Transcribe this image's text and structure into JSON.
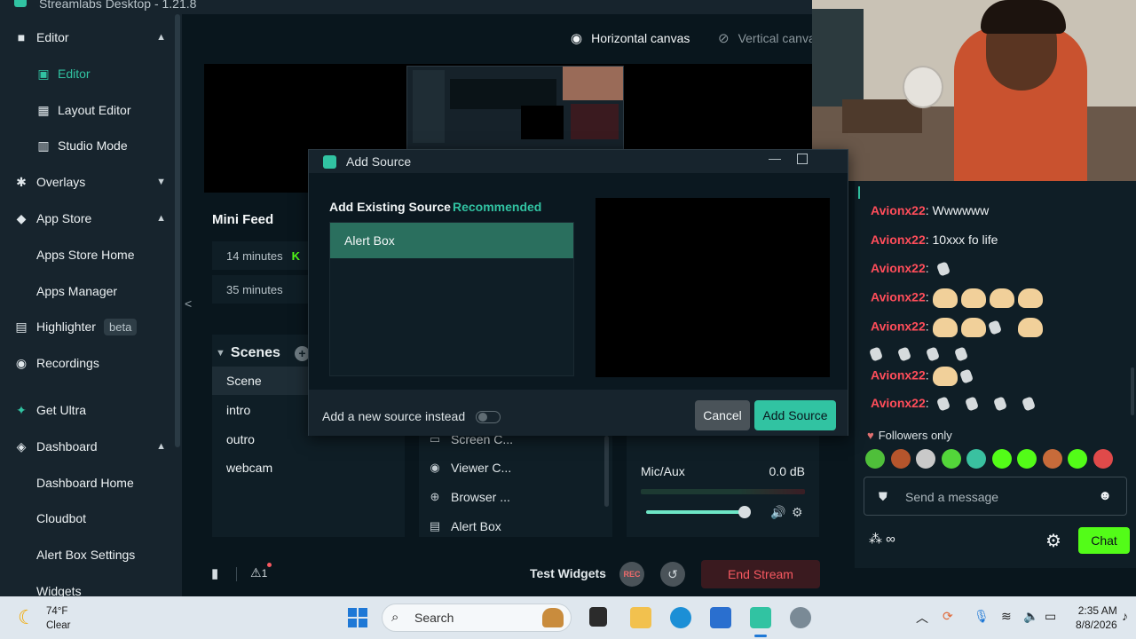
{
  "titlebar": {
    "title": "Streamlabs Desktop - 1.21.8"
  },
  "sidebar": {
    "items": [
      {
        "label": "Editor",
        "icon": "camera-icon",
        "chevron": "▲"
      },
      {
        "label": "Editor",
        "icon": "editor-icon"
      },
      {
        "label": "Layout Editor",
        "icon": "layout-icon"
      },
      {
        "label": "Studio Mode",
        "icon": "studio-icon"
      },
      {
        "label": "Overlays",
        "icon": "overlays-icon",
        "chevron": "▼"
      },
      {
        "label": "App Store",
        "icon": "store-icon",
        "chevron": "▲"
      },
      {
        "label": "Apps Store Home"
      },
      {
        "label": "Apps Manager"
      },
      {
        "label": "Highlighter",
        "icon": "highlighter-icon",
        "badge": "beta"
      },
      {
        "label": "Recordings",
        "icon": "recordings-icon"
      },
      {
        "label": "Get Ultra",
        "icon": "ultra-icon"
      },
      {
        "label": "Dashboard",
        "icon": "dashboard-icon",
        "chevron": "▲"
      },
      {
        "label": "Dashboard Home"
      },
      {
        "label": "Cloudbot"
      },
      {
        "label": "Alert Box Settings"
      },
      {
        "label": "Widgets"
      }
    ]
  },
  "editor": {
    "canvas_horizontal": "Horizontal canvas",
    "canvas_vertical": "Vertical canvas",
    "mini_feed": {
      "title": "Mini Feed",
      "rows": [
        {
          "time": "14 minutes"
        },
        {
          "time": "35 minutes"
        }
      ]
    },
    "scenes": {
      "title": "Scenes",
      "items": [
        "Scene",
        "intro",
        "outro",
        "webcam"
      ]
    },
    "sources": {
      "items": [
        {
          "label": "Screen C...",
          "icon": "monitor-icon"
        },
        {
          "label": "Viewer C...",
          "icon": "eye-icon"
        },
        {
          "label": "Browser ...",
          "icon": "globe-icon"
        },
        {
          "label": "Alert Box",
          "icon": "alert-icon"
        }
      ]
    },
    "mixer": {
      "label": "Mic/Aux",
      "db": "0.0 dB",
      "volume": 0.85
    }
  },
  "footer": {
    "alerts_count": "1",
    "test_widgets": "Test Widgets",
    "rec": "REC",
    "end_stream": "End Stream"
  },
  "modal": {
    "title": "Add Source",
    "existing_label": "Add Existing Source",
    "recommended": "Recommended",
    "selected_item": "Alert Box",
    "new_source_label": "Add a new source instead",
    "new_source_toggle": false,
    "cancel": "Cancel",
    "add_source": "Add Source"
  },
  "chat": {
    "messages": [
      {
        "user": "Avionx22",
        "text": ": Wwwwww"
      },
      {
        "user": "Avionx22",
        "text": ": 10xxx fo life"
      },
      {
        "user": "Avionx22",
        "text": ":"
      },
      {
        "user": "Avionx22",
        "text": ":"
      },
      {
        "user": "Avionx22",
        "text": ":"
      },
      {
        "user": "Avionx22",
        "text": ":"
      },
      {
        "user": "Avionx22",
        "text": ":"
      }
    ],
    "followers_only": "Followers only",
    "input_placeholder": "Send a message",
    "infinity": "∞",
    "chat_button": "Chat",
    "accent_color": "#53fc18",
    "username_color": "#ff4d5a"
  },
  "taskbar": {
    "temperature": "74°F",
    "weather": "Clear",
    "search": "Search",
    "time": "2:35 AM",
    "date": "8/8/2026"
  },
  "colors": {
    "accent": "#31c3a2",
    "background": "#09161d",
    "panel": "#17242d"
  }
}
